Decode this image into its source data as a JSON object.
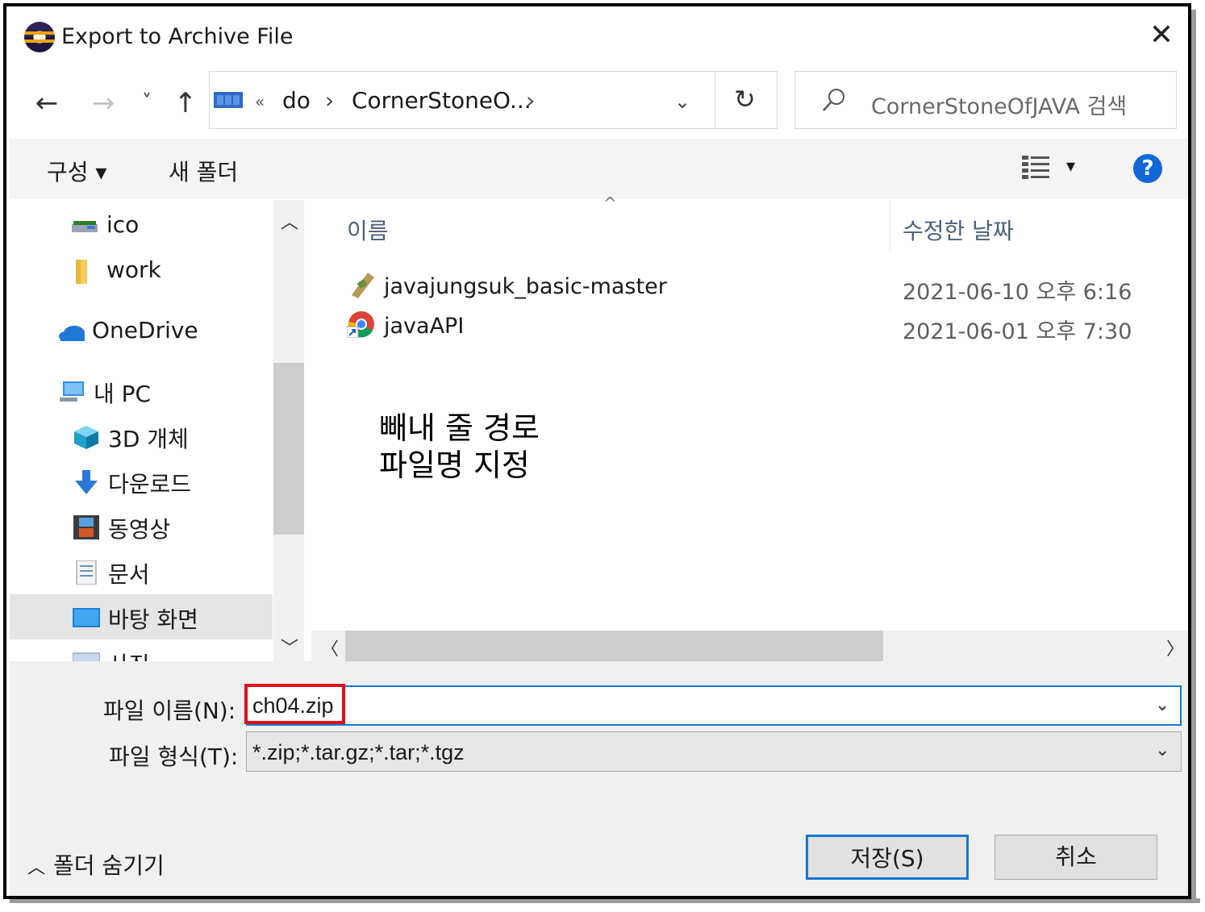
{
  "window": {
    "title": "Export to Archive File"
  },
  "nav": {
    "back": "←",
    "forward": "→",
    "recent": "˅",
    "up": "↑",
    "breadcrumb": {
      "overflow": "«",
      "items": [
        "do",
        "CornerStoneO..."
      ],
      "separator": "›"
    },
    "refresh": "↻",
    "search_placeholder": "CornerStoneOfJAVA 검색"
  },
  "toolbar": {
    "organize": "구성 ▾",
    "new_folder": "새 폴더",
    "view_menu": "▾",
    "help": "?"
  },
  "sidebar": {
    "items": [
      {
        "label": "ico",
        "icon": "drive-icon"
      },
      {
        "label": "work",
        "icon": "folder-icon"
      },
      {
        "label": "OneDrive",
        "icon": "cloud-icon"
      },
      {
        "label": "내 PC",
        "icon": "pc-icon"
      },
      {
        "label": "3D 개체",
        "icon": "cube-icon"
      },
      {
        "label": "다운로드",
        "icon": "download-icon"
      },
      {
        "label": "동영상",
        "icon": "video-icon"
      },
      {
        "label": "문서",
        "icon": "document-icon"
      },
      {
        "label": "바탕 화면",
        "icon": "desktop-icon"
      },
      {
        "label": "사진",
        "icon": "picture-icon"
      }
    ],
    "selected": "바탕 화면"
  },
  "files": {
    "columns": [
      "이름",
      "수정한 날짜"
    ],
    "sort_indicator": "^",
    "rows": [
      {
        "name": "javajungsuk_basic-master",
        "date": "2021-06-10 오후 6:16",
        "icon": "archive-icon"
      },
      {
        "name": "javaAPI",
        "date": "2021-06-01 오후 7:30",
        "icon": "chrome-shortcut-icon"
      }
    ]
  },
  "annotation": "빼내 줄 경로\n파일명 지정",
  "form": {
    "file_name_label": "파일 이름(N):",
    "file_name_value": "ch04.zip",
    "file_type_label": "파일 형식(T):",
    "file_type_value": "*.zip;*.tar.gz;*.tar;*.tgz"
  },
  "footer": {
    "hide_folders": "폴더 숨기기",
    "save": "저장(S)",
    "cancel": "취소"
  },
  "colors": {
    "accent": "#1677d2",
    "highlight_box": "#e0101b",
    "selected_bg": "#e5e5e5"
  }
}
